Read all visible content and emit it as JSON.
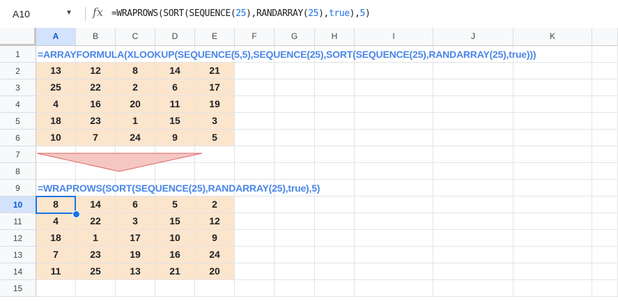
{
  "formula_bar": {
    "name_box": "A10",
    "fx_label": "fx",
    "formula_tokens": [
      {
        "t": "=WRAPROWS(SORT(SEQUENCE(",
        "c": "fn"
      },
      {
        "t": "25",
        "c": "num"
      },
      {
        "t": "),RANDARRAY(",
        "c": "fn"
      },
      {
        "t": "25",
        "c": "num"
      },
      {
        "t": "),",
        "c": "fn"
      },
      {
        "t": "true",
        "c": "kw"
      },
      {
        "t": "),",
        "c": "fn"
      },
      {
        "t": "5",
        "c": "num"
      },
      {
        "t": ")",
        "c": "fn"
      }
    ]
  },
  "columns": [
    "A",
    "B",
    "C",
    "D",
    "E",
    "F",
    "G",
    "H",
    "I",
    "J",
    "K"
  ],
  "rows": [
    "1",
    "2",
    "3",
    "4",
    "5",
    "6",
    "7",
    "8",
    "9",
    "10",
    "11",
    "12",
    "13",
    "14",
    "15"
  ],
  "selected_cell": {
    "column": "A",
    "row": "10"
  },
  "row1_formula": "=ARRAYFORMULA(XLOOKUP(SEQUENCE(5,5),SEQUENCE(25),SORT(SEQUENCE(25),RANDARRAY(25),true)))",
  "row9_formula": "=WRAPROWS(SORT(SEQUENCE(25),RANDARRAY(25),true),5)",
  "table_top": [
    [
      "13",
      "12",
      "8",
      "14",
      "21"
    ],
    [
      "25",
      "22",
      "2",
      "6",
      "17"
    ],
    [
      "4",
      "16",
      "20",
      "11",
      "19"
    ],
    [
      "18",
      "23",
      "1",
      "15",
      "3"
    ],
    [
      "10",
      "7",
      "24",
      "9",
      "5"
    ]
  ],
  "table_bottom": [
    [
      "8",
      "14",
      "6",
      "5",
      "2"
    ],
    [
      "4",
      "22",
      "3",
      "15",
      "12"
    ],
    [
      "18",
      "1",
      "17",
      "10",
      "9"
    ],
    [
      "7",
      "23",
      "19",
      "16",
      "24"
    ],
    [
      "11",
      "25",
      "13",
      "21",
      "20"
    ]
  ],
  "colors": {
    "cell_fill": "#fce5cd",
    "formula_text": "#4a86e8",
    "arrow_fill": "#f4c7c3",
    "arrow_stroke": "#e06666",
    "selection": "#1a73e8"
  }
}
